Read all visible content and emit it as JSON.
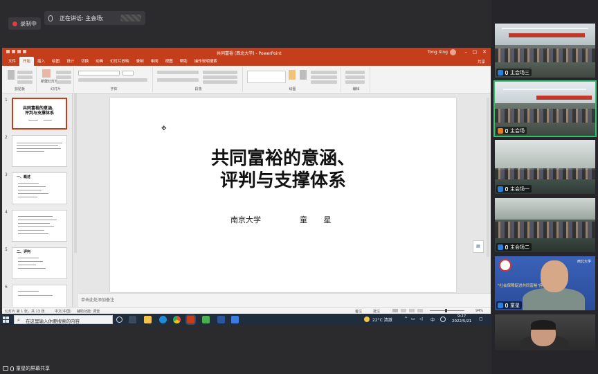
{
  "meeting": {
    "recording_label": "录制中",
    "speaking_label": "正在讲话: 主会场;",
    "screen_share_label": "童星的屏幕共享"
  },
  "ppt": {
    "window_title": "共同富裕 (西北大学)  -  PowerPoint",
    "user_name": "Tong Xing",
    "tabs": [
      "文件",
      "开始",
      "插入",
      "绘图",
      "设计",
      "切换",
      "动画",
      "幻灯片放映",
      "录制",
      "审阅",
      "视图",
      "帮助",
      "操作说明搜索"
    ],
    "active_tab": "开始",
    "share_label": "共享",
    "ribbon_groups": [
      "剪贴板",
      "幻灯片",
      "字体",
      "段落",
      "绘图",
      "编辑"
    ],
    "new_slide_label": "新建幻灯片",
    "slide_numbers": [
      "1",
      "2",
      "3",
      "4",
      "5",
      "6"
    ],
    "thumb1_title_line1": "共同富裕的意涵、",
    "thumb1_title_line2": "评判与支撑体系",
    "thumb3_title": "一、概述",
    "thumb5_title": "二、评判",
    "notes_placeholder": "单击此处添加备注",
    "status_left": "幻灯片 第 1 张，共 13 张",
    "status_lang": "中文(中国)",
    "status_access": "辅助功能: 调查",
    "status_notes": "备注",
    "status_comments": "批注",
    "zoom": "94%"
  },
  "slide": {
    "title_line1": "共同富裕的意涵、",
    "title_line2": "评判与支撑体系",
    "affiliation": "南京大学",
    "author": "童 星"
  },
  "taskbar": {
    "search_placeholder": "在这里输入你要搜索的内容",
    "weather": "22°C 清澈",
    "ime": "中",
    "time": "9:27",
    "date": "2022/5/21"
  },
  "participants": [
    {
      "label": "主会场三"
    },
    {
      "label": "主会场"
    },
    {
      "label": "主会场一"
    },
    {
      "label": "主会场二"
    },
    {
      "label": "童星"
    },
    {
      "label": ""
    }
  ],
  "conference": {
    "banner_text": "\"社会保障促进共同富裕\"座谈会",
    "university": "西北大学"
  },
  "colors": {
    "ppt_red": "#c43e1c",
    "active_speaker": "#38c172",
    "taskbar": "#1f2d3d"
  }
}
